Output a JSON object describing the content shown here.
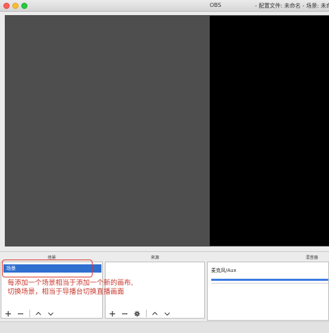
{
  "window": {
    "app_title": "OBS",
    "title_detail": "- 配置文件: 未命名 - 场景: 未命"
  },
  "panels": {
    "scenes": {
      "header": "场景",
      "items": [
        "场景"
      ]
    },
    "sources": {
      "header": "来源"
    },
    "mixer": {
      "header": "混音器",
      "channel_label": "麦克风/Aux"
    }
  },
  "toolbar_icons": {
    "scenes": [
      "plus-icon",
      "minus-icon",
      "chevron-up-icon",
      "chevron-down-icon"
    ],
    "sources": [
      "plus-icon",
      "minus-icon",
      "gear-icon",
      "chevron-up-icon",
      "chevron-down-icon"
    ]
  },
  "annotation": {
    "line1": "每添加一个场景相当于添加一个新的画布,",
    "line2": "切换场景，相当于导播台切换直播画面",
    "color": "#c8392e"
  },
  "colors": {
    "preview_bg": "#4e4e4e",
    "canvas_bg": "#000000",
    "selection": "#2f6fd0",
    "meter": "#3b7ae0"
  }
}
